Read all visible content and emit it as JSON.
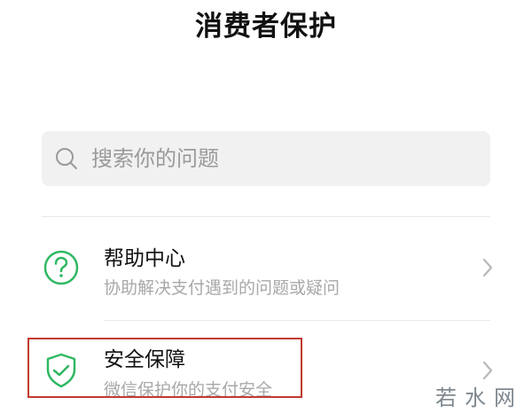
{
  "header": {
    "title": "消费者保护"
  },
  "search": {
    "placeholder": "搜索你的问题"
  },
  "items": [
    {
      "label": "帮助中心",
      "description": "协助解决支付遇到的问题或疑问",
      "icon": "question-circle-icon"
    },
    {
      "label": "安全保障",
      "description": "微信保护你的支付安全",
      "icon": "shield-check-icon"
    }
  ],
  "watermark": "若水网",
  "colors": {
    "accent": "#2fb862",
    "highlight": "#c23a2f"
  }
}
